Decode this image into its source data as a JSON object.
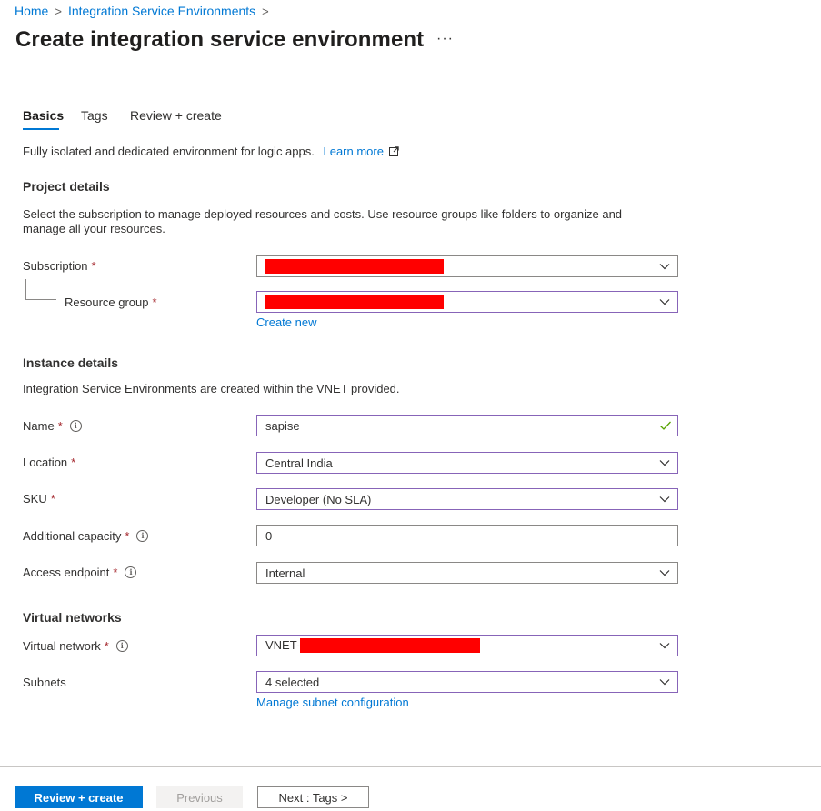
{
  "breadcrumb": {
    "home": "Home",
    "ise": "Integration Service Environments",
    "separator": ">"
  },
  "title": "Create integration service environment",
  "more": "···",
  "tabs": [
    {
      "label": "Basics",
      "active": true
    },
    {
      "label": "Tags",
      "active": false
    },
    {
      "label": "Review + create",
      "active": false
    }
  ],
  "intro": {
    "text": "Fully isolated and dedicated environment for logic apps.",
    "learn_more": "Learn more"
  },
  "project_details": {
    "heading": "Project details",
    "description": "Select the subscription to manage deployed resources and costs. Use resource groups like folders to organize and manage all your resources.",
    "subscription_label": "Subscription",
    "resource_group_label": "Resource group",
    "create_new": "Create new"
  },
  "instance_details": {
    "heading": "Instance details",
    "description": "Integration Service Environments are created within the VNET provided.",
    "name_label": "Name",
    "name_value": "sapise",
    "location_label": "Location",
    "location_value": "Central India",
    "sku_label": "SKU",
    "sku_value": "Developer (No SLA)",
    "capacity_label": "Additional capacity",
    "capacity_value": "0",
    "endpoint_label": "Access endpoint",
    "endpoint_value": "Internal"
  },
  "virtual_networks": {
    "heading": "Virtual networks",
    "vnet_label": "Virtual network",
    "vnet_value_prefix": "VNET-",
    "subnets_label": "Subnets",
    "subnets_value": "4 selected",
    "manage_subnets": "Manage subnet configuration"
  },
  "required_marker": "*",
  "info_glyph": "i",
  "footer": {
    "review_create": "Review + create",
    "previous": "Previous",
    "next": "Next : Tags >"
  },
  "colors": {
    "accent": "#0078d4",
    "required": "#a4262c",
    "focus_border": "#8764b8",
    "valid_check": "#57a300",
    "redaction": "#ff0000"
  },
  "icons": {
    "dropdown": "chevron-down-icon",
    "valid": "checkmark-icon",
    "info": "info-icon",
    "external": "external-link-icon",
    "more": "more-icon"
  }
}
